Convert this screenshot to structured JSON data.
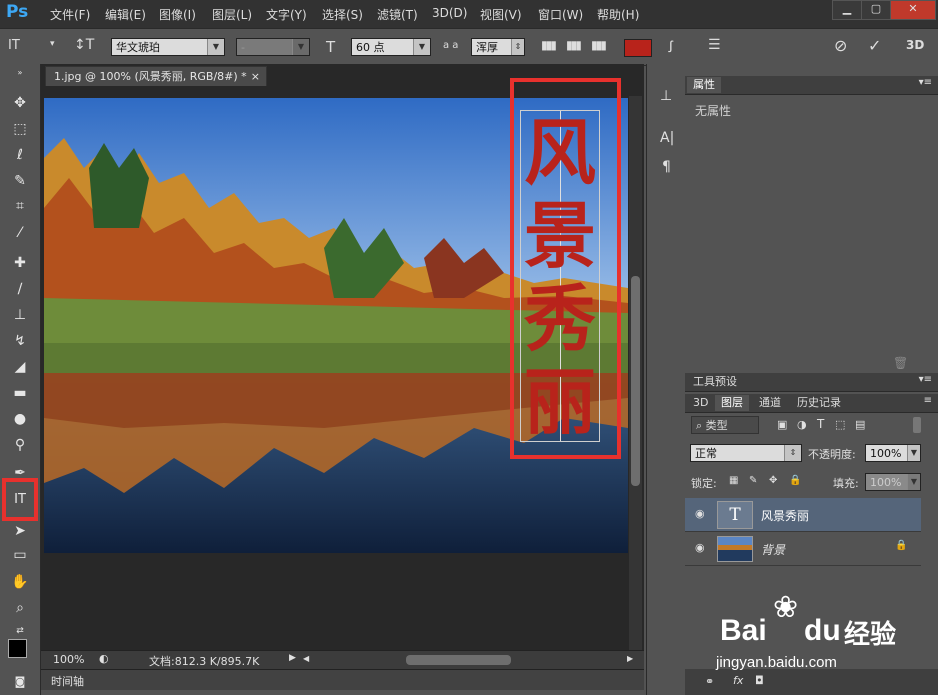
{
  "app": {
    "logo": "Ps"
  },
  "menu": [
    "文件(F)",
    "编辑(E)",
    "图像(I)",
    "图层(L)",
    "文字(Y)",
    "选择(S)",
    "滤镜(T)",
    "3D(D)",
    "视图(V)",
    "窗口(W)",
    "帮助(H)"
  ],
  "window_controls": {
    "minimize": "▁",
    "maximize": "▢",
    "close": "✕"
  },
  "options": {
    "tool_glyph": "IT",
    "orientation_glyph": "↕T",
    "font_family": "华文琥珀",
    "font_style": "-",
    "size_glyph": "T",
    "font_size": "60 点",
    "aa_glyph": "a a",
    "antialias": "浑厚",
    "color": "#b8231b",
    "cancel_glyph": "⃠",
    "commit_glyph": "✓",
    "threed": "3D"
  },
  "document": {
    "tab_title": "1.jpg @ 100% (风景秀丽, RGB/8#) *",
    "tab_close": "×",
    "vertical_text": [
      "风",
      "景",
      "秀",
      "丽"
    ],
    "text_color": "#b8231b"
  },
  "status": {
    "zoom": "100%",
    "doc_info": "文档:812.3 K/895.7K"
  },
  "timeline": {
    "label": "时间轴"
  },
  "properties_panel": {
    "title": "属性",
    "content": "无属性"
  },
  "tool_presets_panel": {
    "title": "工具预设"
  },
  "layers_panel": {
    "tabs": [
      "3D",
      "图层",
      "通道",
      "历史记录"
    ],
    "active_tab": "图层",
    "filter_kind": "类型",
    "blend_mode": "正常",
    "opacity_label": "不透明度:",
    "opacity_value": "100%",
    "lock_label": "锁定:",
    "fill_label": "填充:",
    "fill_value": "100%",
    "layers": [
      {
        "name": "风景秀丽",
        "type": "text",
        "thumb": "T"
      },
      {
        "name": "背景",
        "type": "image",
        "locked": true
      }
    ]
  },
  "watermark": {
    "brand": "Bai",
    "brand2": "经验",
    "url": "jingyan.baidu.com"
  }
}
